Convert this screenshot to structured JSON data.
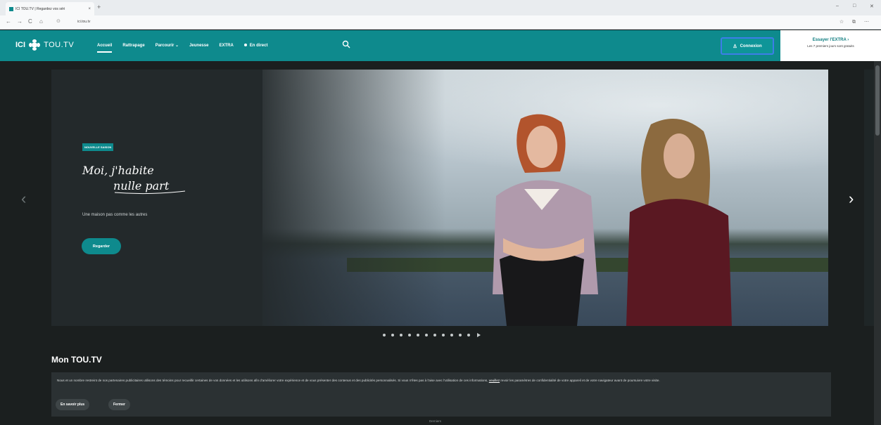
{
  "browser": {
    "tab_title": "ICI TOU.TV | Regardez vos séri",
    "tab_close": "×",
    "new_tab": "+",
    "url": "ici.tou.tv",
    "nav_back": "←",
    "nav_forward": "→",
    "reload": "C",
    "home": "⌂",
    "window_min": "–",
    "window_max": "□",
    "window_close": "✕"
  },
  "header": {
    "logo_ici": "ICI",
    "logo_toutv": "TOU.TV",
    "nav": {
      "accueil": "Accueil",
      "rattrapage": "Rattrapage",
      "parcourir": "Parcourir",
      "jeunesse": "Jeunesse",
      "extra": "EXTRA",
      "en_direct": "En direct"
    },
    "connexion_label": "Connexion",
    "extra_cta": {
      "title": "Essayer l'EXTRA",
      "subtitle": "Les 7 premiers jours sont gratuits"
    }
  },
  "hero": {
    "badge": "NOUVELLE SAISON",
    "show_title_line1": "Moi, j'habite",
    "show_title_line2": "nulle part",
    "tagline": "Une maison pas comme les autres",
    "watch_label": "Regarder",
    "prev_arrow": "‹",
    "next_arrow": "›",
    "slide_count": 11
  },
  "main": {
    "section_title": "Mon TOU.TV"
  },
  "cookie_banner": {
    "text": "Nous et un nombre restreint de nos partenaires publicitaires utilisons des témoins pour recueillir certaines de vos données et les utilisons afin d'améliorer votre expérience et de vous présenter des contenus et des publicités personnalisés. Si vous n'êtes pas à l'aise avec l'utilisation de ces informations,",
    "link": "veuillez",
    "text2": "revoir les paramètres de confidentialité de votre appareil et de votre navigateur avant de poursuivre votre visite.",
    "more_label": "En savoir plus",
    "close_label": "Fermer"
  },
  "footer_label": "Derniers",
  "colors": {
    "brand_teal": "#0e8a8d",
    "background": "#1b1f1f"
  }
}
